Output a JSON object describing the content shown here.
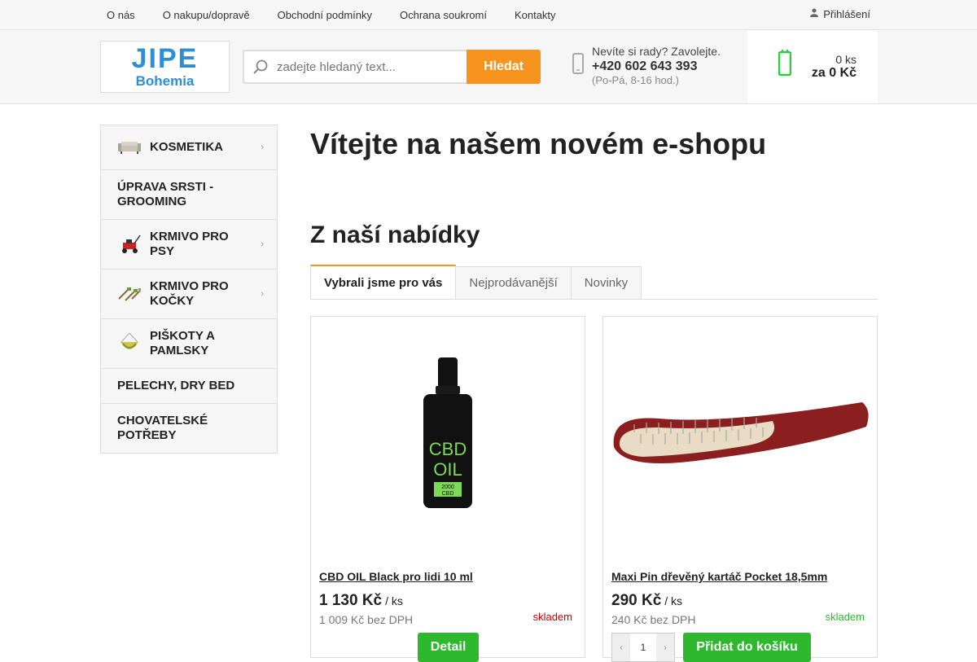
{
  "topnav": {
    "links": [
      "O nás",
      "O nakupu/dopravě",
      "Obchodní podmínky",
      "Ochrana soukromí",
      "Kontakty"
    ],
    "login_label": "Přihlášení",
    "login_icon": "user-icon"
  },
  "header": {
    "logo_line1": "JIPE",
    "logo_line2": "Bohemia",
    "search_placeholder": "zadejte hledaný text...",
    "search_button": "Hledat",
    "contact_prompt": "Nevíte si rady? Zavolejte.",
    "contact_phone": "+420 602 643 393",
    "contact_hours": "(Po-Pá, 8-16 hod.)",
    "phone_icon": "phone-icon",
    "cart_qty": "0 ks",
    "cart_total": "za 0 Kč",
    "cart_icon": "cart-icon"
  },
  "sidebar": {
    "categories": [
      {
        "label": "KOSMETIKA",
        "icon": "sofa-icon",
        "has_sub": true
      },
      {
        "label": "ÚPRAVA SRSTI - GROOMING",
        "icon": "",
        "has_sub": false
      },
      {
        "label": "KRMIVO PRO PSY",
        "icon": "lawnmower-icon",
        "has_sub": true
      },
      {
        "label": "KRMIVO PRO KOČKY",
        "icon": "garden-tools-icon",
        "has_sub": true
      },
      {
        "label": "PIŠKOTY A PAMLSKY",
        "icon": "hammock-icon",
        "has_sub": true
      },
      {
        "label": "PELECHY, DRY BED",
        "icon": "",
        "has_sub": false
      },
      {
        "label": "CHOVATELSKÉ POTŘEBY",
        "icon": "",
        "has_sub": false
      }
    ]
  },
  "main": {
    "welcome_title": "Vítejte na našem novém e-shopu",
    "offer_title": "Z naší nabídky",
    "tabs": [
      "Vybrali jsme pro vás",
      "Nejprodávanější",
      "Novinky"
    ],
    "active_tab": 0
  },
  "products": [
    {
      "name": "CBD OIL Black pro lidi 10 ml",
      "price": "1 130 Kč",
      "unit": "/ ks",
      "net_price": "1 009 Kč bez DPH",
      "stock": "skladem",
      "stock_color": "#cc0000",
      "button": "Detail",
      "bottle_text_1": "CBD",
      "bottle_text_2": "OIL",
      "bottle_text_3": "2000",
      "bottle_text_4": "CBD"
    },
    {
      "name": "Maxi Pin dřevěný kartáč Pocket 18,5mm",
      "price": "290 Kč",
      "unit": "/ ks",
      "net_price": "240 Kč bez DPH",
      "stock": "skladem",
      "stock_color": "#2eb82e",
      "qty": "1",
      "button": "Přidat do košíku"
    }
  ],
  "colors": {
    "accent_orange": "#f7941d",
    "accent_green": "#2eb82e",
    "logo_blue": "#2d8ed6"
  }
}
